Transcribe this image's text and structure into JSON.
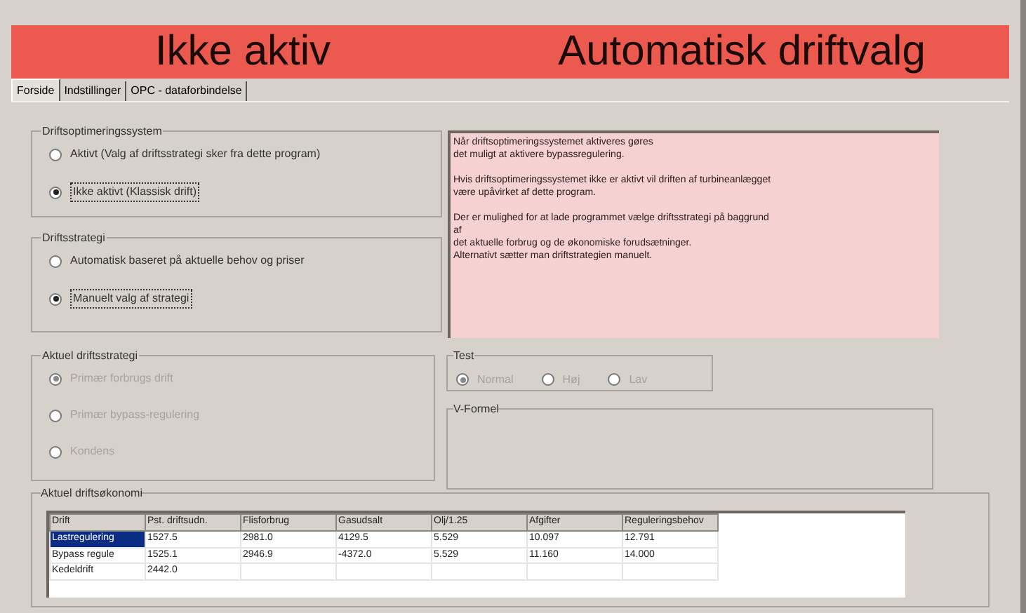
{
  "banner": {
    "status": "Ikke aktiv",
    "mode": "Automatisk driftvalg"
  },
  "tabs": [
    {
      "label": "Forside",
      "selected": true
    },
    {
      "label": "Indstillinger",
      "selected": false
    },
    {
      "label": "OPC - dataforbindelse",
      "selected": false
    }
  ],
  "groups": [
    {
      "title": "Driftsoptimeringssystem",
      "options": [
        {
          "label": "Aktivt (Valg af driftsstrategi sker fra dette program)",
          "selected": false,
          "disabled": false
        },
        {
          "label": "Ikke aktivt (Klassisk drift)",
          "selected": true,
          "disabled": false
        }
      ]
    },
    {
      "title": "Driftsstrategi",
      "options": [
        {
          "label": "Automatisk baseret på aktuelle behov og priser",
          "selected": false,
          "disabled": false
        },
        {
          "label": "Manuelt valg af strategi",
          "selected": true,
          "disabled": false
        }
      ]
    },
    {
      "title": "Aktuel driftsstrategi",
      "options": [
        {
          "label": "Primær forbrugs drift",
          "selected": true,
          "disabled": true
        },
        {
          "label": "Primær bypass-regulering",
          "selected": false,
          "disabled": true
        },
        {
          "label": "Kondens",
          "selected": false,
          "disabled": true
        }
      ]
    }
  ],
  "info_text": [
    [
      "Når driftsoptimeringssystemet aktiveres gøres",
      "det muligt at aktivere bypassregulering."
    ],
    [
      "Hvis driftsoptimeringssystemet ikke er aktivt vil driften af turbineanlægget",
      "være upåvirket af dette program."
    ],
    [
      "Der er mulighed for at lade programmet vælge driftsstrategi på baggrund",
      "af",
      "det aktuelle forbrug og de økonomiske forudsætninger.",
      "Alternativt sætter man driftstrategien manuelt."
    ]
  ],
  "test": {
    "title": "Test",
    "options": [
      {
        "label": "Normal",
        "selected": true,
        "disabled": true
      },
      {
        "label": "Høj",
        "selected": false,
        "disabled": true
      },
      {
        "label": "Lav",
        "selected": false,
        "disabled": true
      }
    ]
  },
  "formula": {
    "title": "V-Formel"
  },
  "economy": {
    "title": "Aktuel driftsøkonomi",
    "columns": [
      "Drift",
      "Pst. driftsudn.",
      "Flisforbrug",
      "Gasudsalt",
      "Olj/1.25",
      "Afgifter",
      "Reguleringsbehov"
    ],
    "rows": [
      {
        "selected": true,
        "cells": [
          "Lastregulering",
          "1527.5",
          "2981.0",
          "4129.5",
          "5.529",
          "10.097",
          "12.791"
        ]
      },
      {
        "selected": false,
        "cells": [
          "Bypass regule",
          "1525.1",
          "2946.9",
          "-4372.0",
          "5.529",
          "11.160",
          "14.000"
        ]
      },
      {
        "selected": false,
        "cells": [
          "Kedeldrift",
          "2442.0",
          "",
          "",
          "",
          "",
          ""
        ]
      }
    ]
  }
}
